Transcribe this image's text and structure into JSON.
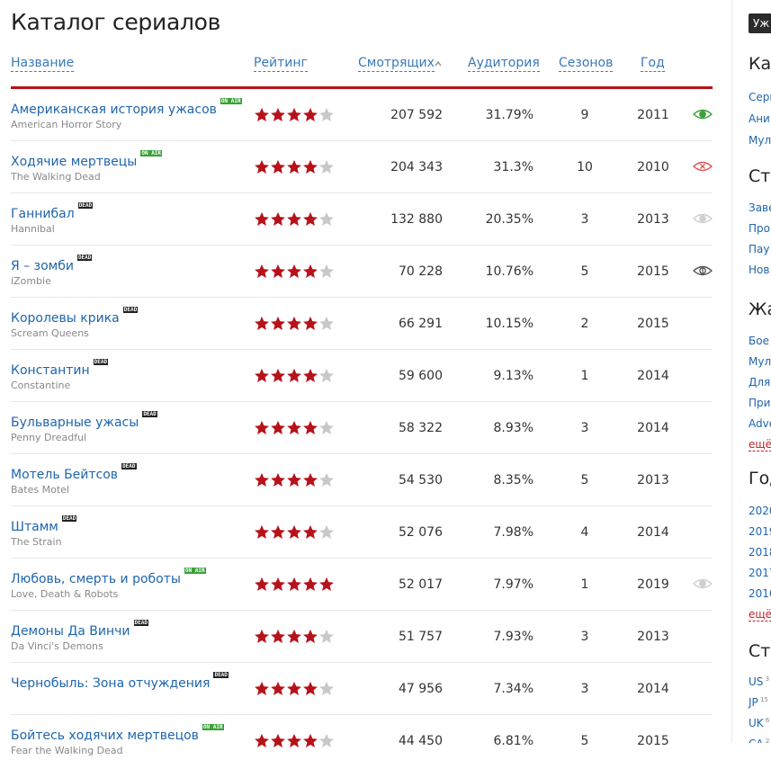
{
  "page": {
    "title": "Каталог сериалов",
    "columns": {
      "name": "Название",
      "rating": "Рейтинг",
      "viewers": "Смотрящих",
      "audience": "Аудитория",
      "seasons": "Сезонов",
      "year": "Год"
    },
    "sorted_by": "viewers"
  },
  "colors": {
    "accent_red": "#b7121a",
    "link_blue": "#1f65ad",
    "star_filled": "#b7121a",
    "star_empty": "#c8c8c8",
    "onair_badge": "#3aa03a",
    "dead_badge": "#222222",
    "eye_watching": "#3aa03a",
    "eye_dropped": "#d9534f",
    "eye_neutral": "#cfcfcf",
    "eye_dark": "#555555"
  },
  "shows": [
    {
      "ru": "Американская история ужасов",
      "en": "American Horror Story",
      "status": "ON AIR",
      "rating": 4,
      "viewers": "207 592",
      "audience": "31.79%",
      "seasons": "9",
      "year": "2011",
      "eye": "watching"
    },
    {
      "ru": "Ходячие мертвецы",
      "en": "The Walking Dead",
      "status": "ON AIR",
      "rating": 4,
      "viewers": "204 343",
      "audience": "31.3%",
      "seasons": "10",
      "year": "2010",
      "eye": "dropped"
    },
    {
      "ru": "Ганнибал",
      "en": "Hannibal",
      "status": "DEAD",
      "rating": 4,
      "viewers": "132 880",
      "audience": "20.35%",
      "seasons": "3",
      "year": "2013",
      "eye": "neutral"
    },
    {
      "ru": "Я – зомби",
      "en": "iZombie",
      "status": "DEAD",
      "rating": 4,
      "viewers": "70 228",
      "audience": "10.76%",
      "seasons": "5",
      "year": "2015",
      "eye": "dark"
    },
    {
      "ru": "Королевы крика",
      "en": "Scream Queens",
      "status": "DEAD",
      "rating": 4,
      "viewers": "66 291",
      "audience": "10.15%",
      "seasons": "2",
      "year": "2015",
      "eye": "none"
    },
    {
      "ru": "Константин",
      "en": "Constantine",
      "status": "DEAD",
      "rating": 4,
      "viewers": "59 600",
      "audience": "9.13%",
      "seasons": "1",
      "year": "2014",
      "eye": "none"
    },
    {
      "ru": "Бульварные ужасы",
      "en": "Penny Dreadful",
      "status": "DEAD",
      "rating": 4,
      "viewers": "58 322",
      "audience": "8.93%",
      "seasons": "3",
      "year": "2014",
      "eye": "none"
    },
    {
      "ru": "Мотель Бейтсов",
      "en": "Bates Motel",
      "status": "DEAD",
      "rating": 4,
      "viewers": "54 530",
      "audience": "8.35%",
      "seasons": "5",
      "year": "2013",
      "eye": "none"
    },
    {
      "ru": "Штамм",
      "en": "The Strain",
      "status": "DEAD",
      "rating": 4,
      "viewers": "52 076",
      "audience": "7.98%",
      "seasons": "4",
      "year": "2014",
      "eye": "none"
    },
    {
      "ru": "Любовь, смерть и роботы",
      "en": "Love, Death & Robots",
      "status": "ON AIR",
      "rating": 5,
      "viewers": "52 017",
      "audience": "7.97%",
      "seasons": "1",
      "year": "2019",
      "eye": "neutral"
    },
    {
      "ru": "Демоны Да Винчи",
      "en": "Da Vinci's Demons",
      "status": "DEAD",
      "rating": 4,
      "viewers": "51 757",
      "audience": "7.93%",
      "seasons": "3",
      "year": "2013",
      "eye": "none"
    },
    {
      "ru": "Чернобыль: Зона отчуждения",
      "en": "",
      "status": "DEAD",
      "rating": 4,
      "viewers": "47 956",
      "audience": "7.34%",
      "seasons": "3",
      "year": "2014",
      "eye": "none"
    },
    {
      "ru": "Бойтесь ходячих мертвецов",
      "en": "Fear the Walking Dead",
      "status": "ON AIR",
      "rating": 4,
      "viewers": "44 450",
      "audience": "6.81%",
      "seasons": "5",
      "year": "2015",
      "eye": "none"
    }
  ],
  "sidebar": {
    "badge": "Уж",
    "sections": [
      {
        "head": "Ка",
        "links": [
          {
            "text": "Сери"
          },
          {
            "text": "Ани"
          },
          {
            "text": "Мул"
          }
        ]
      },
      {
        "head": "Ста",
        "links": [
          {
            "text": "Заве"
          },
          {
            "text": "Про"
          },
          {
            "text": "Пау"
          },
          {
            "text": "Нов"
          }
        ]
      },
      {
        "head": "Жа",
        "links": [
          {
            "text": "Бое"
          },
          {
            "text": "Мул"
          },
          {
            "text": "Для"
          },
          {
            "text": "При"
          },
          {
            "text": "Adve"
          }
        ],
        "more": "ещё"
      },
      {
        "head": "Год",
        "links": [
          {
            "text": "2020"
          },
          {
            "text": "2019"
          },
          {
            "text": "2018"
          },
          {
            "text": "2017"
          },
          {
            "text": "2016"
          }
        ],
        "more": "ещё"
      },
      {
        "head": "Стр",
        "links": [
          {
            "text": "US",
            "sup": "3"
          },
          {
            "text": "JP",
            "sup": "15"
          },
          {
            "text": "UK",
            "sup": "6"
          },
          {
            "text": "CA",
            "sup": "2"
          }
        ]
      }
    ]
  }
}
